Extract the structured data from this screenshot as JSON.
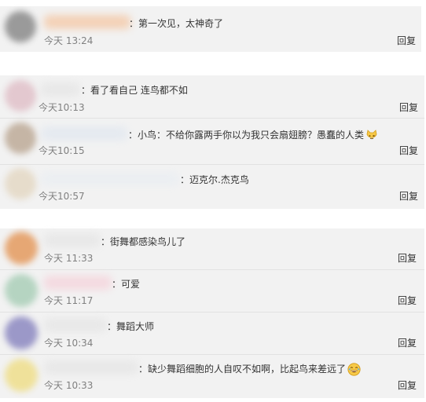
{
  "cards": [
    {
      "comments": [
        {
          "text": "：第一次见，太神奇了",
          "time": "今天 13:24",
          "reply": "回复"
        }
      ]
    },
    {
      "comments": [
        {
          "text": "：看了看自己 连鸟都不如",
          "time": "今天10:13",
          "reply": "回复"
        },
        {
          "text": "：小鸟：不给你露两手你以为我只会扇翅膀？愚蠢的人类",
          "emoji": "cat-face-emoji",
          "time": "今天10:15",
          "reply": "回复"
        },
        {
          "text": "：迈克尔.杰克鸟",
          "time": "今天10:57",
          "reply": "回复"
        }
      ]
    },
    {
      "comments": [
        {
          "text": "：街舞都感染鸟儿了",
          "time": "今天 11:33",
          "reply": "回复"
        },
        {
          "text": "：可爱",
          "time": "今天 11:17",
          "reply": "回复"
        },
        {
          "text": "：舞蹈大师",
          "time": "今天 10:34",
          "reply": "回复"
        },
        {
          "text": "：缺少舞蹈细胞的人自叹不如啊，比起鸟来差远了",
          "emoji": "laughing-emoji",
          "time": "今天 10:33",
          "reply": "回复"
        }
      ]
    }
  ],
  "colors": {
    "card_bg": "#f2f2f2",
    "text": "#333333",
    "time": "#808080",
    "divider": "#e2e2e2"
  }
}
